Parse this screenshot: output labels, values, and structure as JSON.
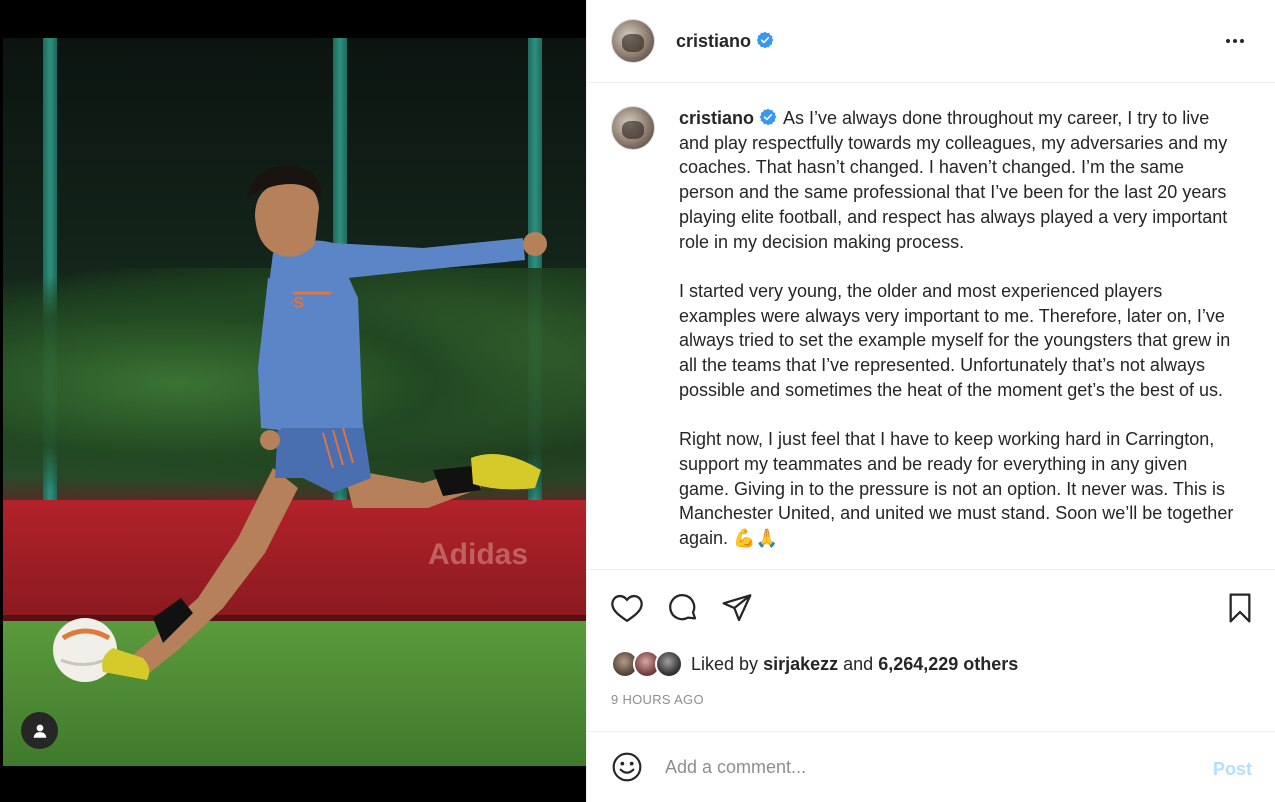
{
  "post": {
    "author": "cristiano",
    "caption_paragraphs": [
      "As I’ve always done throughout my career, I try to live and play respectfully towards my colleagues, my adversaries and my coaches. That hasn’t changed. I haven’t changed. I’m the same person and the same professional that I’ve been for the last 20 years playing elite football, and respect has always played a very important role in my decision making process.",
      "I started very young, the older and most experienced players examples were always very important to me. Therefore, later on, I’ve always tried to set the example myself for the youngsters that grew in all the teams that I’ve represented. Unfortunately that’s not always possible and sometimes the heat of the moment get’s the best of us.",
      "Right now, I just feel that I have to keep working hard in Carrington, support my teammates and be ready for everything in any given game. Giving in to the pressure is not an option. It never was. This is Manchester United, and united we must stand. Soon we’ll be together again. 💪🙏"
    ],
    "liked_by_prefix": "Liked by",
    "liked_by_user": "sirjakezz",
    "liked_by_and": "and",
    "liked_by_others": "6,264,229 others",
    "time_ago": "9 HOURS AGO"
  },
  "comment_box": {
    "placeholder": "Add a comment...",
    "post_label": "Post"
  },
  "photo": {
    "banner_text": "Adidas"
  },
  "icons": {
    "more": "more-options-icon",
    "like": "heart-icon",
    "comment": "comment-bubble-icon",
    "share": "paper-plane-icon",
    "save": "bookmark-icon",
    "emoji": "smiley-icon",
    "verified": "verified-badge-icon",
    "user": "user-icon"
  },
  "colors": {
    "verified_blue": "#3897f0",
    "post_disabled": "#b2dffc",
    "muted": "#8e8e8e",
    "text": "#262626"
  }
}
